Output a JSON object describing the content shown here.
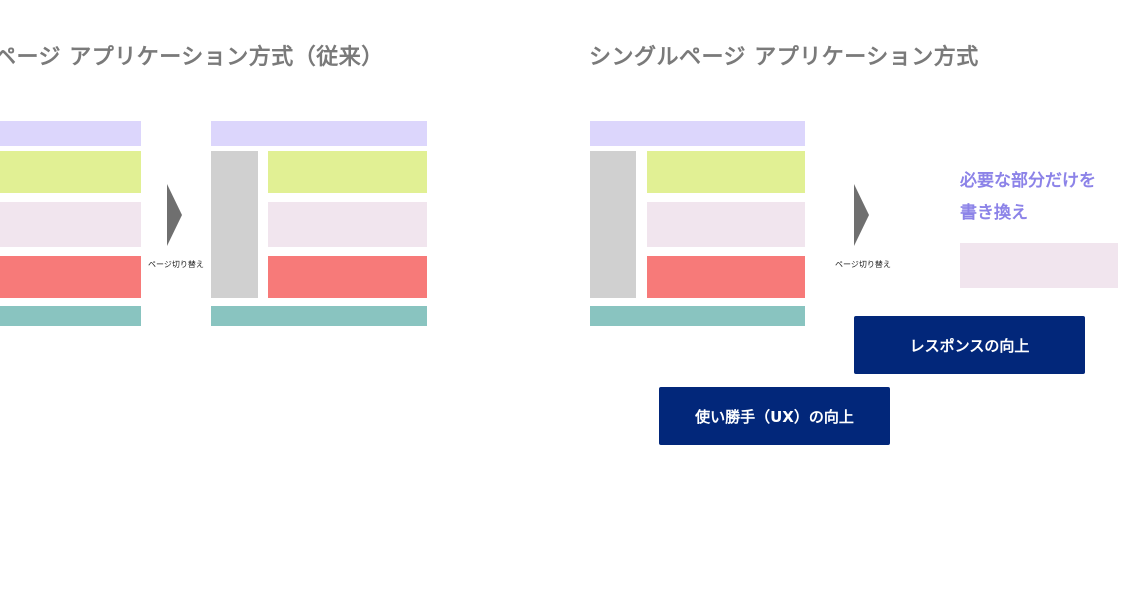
{
  "left_section": {
    "title": "ページ アプリケーション方式（従来）",
    "caption": "ページ切り替え"
  },
  "right_section": {
    "title": "シングルページ アプリケーション方式",
    "caption": "ページ切り替え",
    "note_line1": "必要な部分だけを",
    "note_line2": "書き換え"
  },
  "buttons": {
    "response": "レスポンスの向上",
    "usability": "使い勝手（UX）の向上"
  },
  "colors": {
    "header": "#dcd6fc",
    "green": "#e1f094",
    "pink": "#f1e5ee",
    "red": "#f77a79",
    "teal": "#89c4c0",
    "sidebar": "#d0d0d0",
    "arrow": "#6f6f6f",
    "accent_text": "#8c83e8",
    "button_bg": "#02277a"
  }
}
